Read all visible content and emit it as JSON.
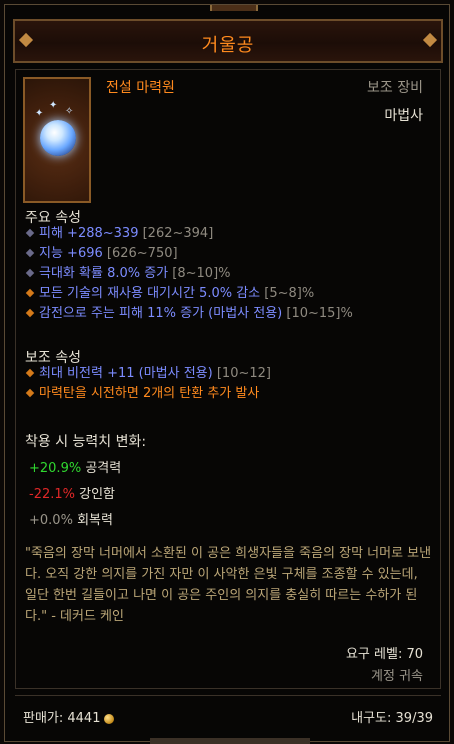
{
  "item": {
    "name": "거울공",
    "type": "전설 마력원",
    "slot": "보조 장비",
    "class": "마법사"
  },
  "primary": {
    "header": "주요 속성",
    "stats": [
      {
        "value": "피해 +288~339",
        "range": "[262~394]",
        "style": "blue"
      },
      {
        "value": "지능 +696",
        "range": "[626~750]",
        "style": "blue"
      },
      {
        "value": "극대화 확률 8.0% 증가",
        "range": "[8~10]%",
        "style": "blue"
      },
      {
        "value": "모든 기술의 재사용 대기시간 5.0% 감소",
        "range": "[5~8]%",
        "style": "orange"
      },
      {
        "value": "감전으로 주는 피해 11% 증가 (마법사 전용)",
        "range": "[10~15]%",
        "style": "orange"
      }
    ]
  },
  "secondary": {
    "header": "보조 속성",
    "stats": [
      {
        "value": "최대 비전력 +11 (마법사 전용)",
        "range": "[10~12]",
        "style": "orange"
      },
      {
        "value": "마력탄을 시전하면 2개의 탄환 추가 발사",
        "range": "",
        "style": "orange"
      }
    ]
  },
  "changes": {
    "header": "착용 시 능력치 변화:",
    "items": [
      {
        "delta": "+20.9%",
        "label": "공격력"
      },
      {
        "delta": "-22.1%",
        "label": "강인함"
      },
      {
        "delta": "+0.0%",
        "label": "회복력"
      }
    ]
  },
  "flavor": "\"죽음의 장막 너머에서 소환된 이 공은 희생자들을 죽음의 장막 너머로 보낸다. 오직 강한 의지를 가진 자만 이 사악한 은빛 구체를 조종할 수 있는데, 일단 한번 길들이고 나면 이 공은 주인의 의지를 충실히 따르는 수하가 된다.\" - 데커드 케인",
  "requirement": "요구 레벨: 70",
  "bound": "계정 귀속",
  "footer": {
    "price": "판매가: 4441",
    "durability": "내구도: 39/39"
  },
  "colors": {
    "title": "#ff8a1e",
    "magic": "#7c8cff",
    "legendary_affix": "#ff8a1e",
    "positive": "#30d830",
    "negative": "#e02828",
    "flavor": "#bba677"
  },
  "icons": [
    "orb-portrait-icon",
    "gold-coin-icon"
  ]
}
